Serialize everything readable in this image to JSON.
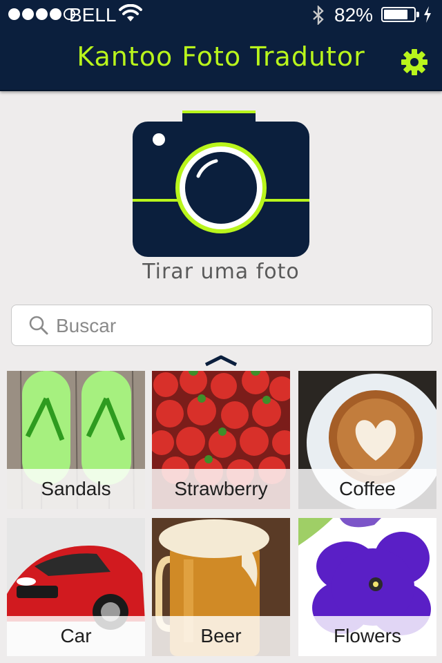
{
  "status_bar": {
    "carrier": "BELL",
    "battery_percent": "82%",
    "battery_level": 0.82,
    "signal_bars_filled": 4,
    "signal_bars_total": 5
  },
  "header": {
    "title": "Kantoo Foto Tradutor",
    "title_color": "#b9f51c",
    "settings_icon": "gear-icon",
    "background": "#0b1f3d"
  },
  "camera": {
    "label": "Tirar uma foto",
    "icon": "camera-icon"
  },
  "search": {
    "placeholder": "Buscar",
    "value": "",
    "icon": "search-icon"
  },
  "categories": [
    {
      "label": "Sandals"
    },
    {
      "label": "Strawberry"
    },
    {
      "label": "Coffee"
    },
    {
      "label": "Car"
    },
    {
      "label": "Beer"
    },
    {
      "label": "Flowers"
    }
  ]
}
